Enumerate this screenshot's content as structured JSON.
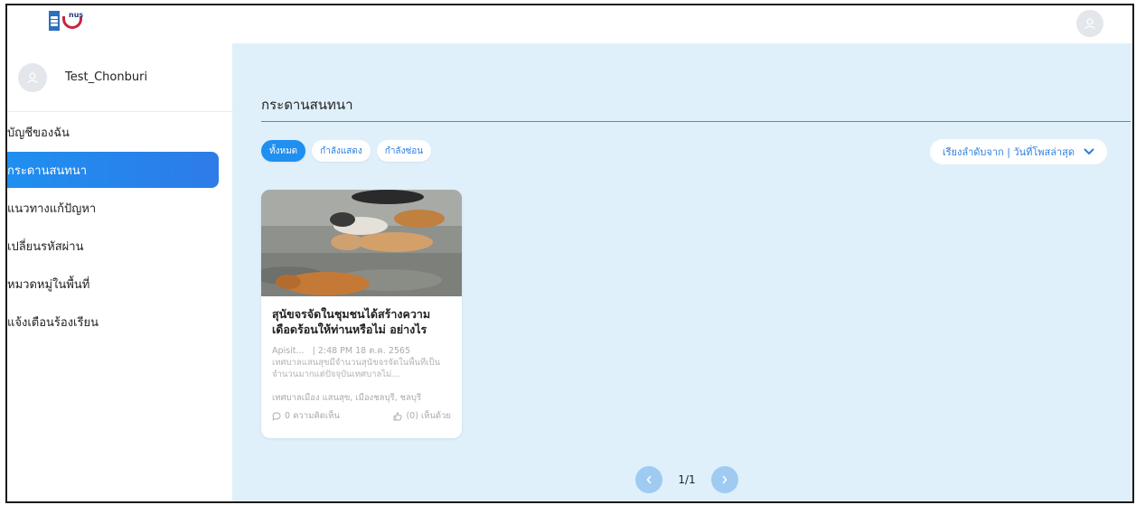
{
  "user": {
    "name": "Test_Chonburi"
  },
  "nav": [
    {
      "label": "บัญชีของฉัน",
      "active": false
    },
    {
      "label": "กระดานสนทนา",
      "active": true
    },
    {
      "label": "แนวทางแก้ปัญหา",
      "active": false
    },
    {
      "label": "เปลี่ยนรหัสผ่าน",
      "active": false
    },
    {
      "label": "หมวดหมู่ในพื้นที่",
      "active": false
    },
    {
      "label": "แจ้งเตือนร้องเรียน",
      "active": false
    }
  ],
  "main": {
    "title": "กระดานสนทนา",
    "filters": [
      {
        "label": "ทั้งหมด",
        "active": true
      },
      {
        "label": "กำลังแสดง",
        "active": false
      },
      {
        "label": "กำลังซ่อน",
        "active": false
      }
    ],
    "sort_label": "เรียงลำดับจาก | วันที่โพสล่าสุด"
  },
  "posts": [
    {
      "title": "สุนัขจรจัดในชุมชนได้สร้างความเดือดร้อนให้ท่านหรือไม่ อย่างไร",
      "author": "Apisit...",
      "datetime": "| 2:48 PM 18 ต.ค. 2565",
      "excerpt": "เทศบาลแสนสุขมีจำนวนสุนัขจรจัดในพื้นที่เป็นจำนวนมากแต่ปัจจุบันเทศบาลไม่...",
      "location": "เทศบาลเมือง แสนสุข, เมืองชลบุรี, ชลบุรี",
      "comments": "0 ความคิดเห็น",
      "agree": "(0) เห็นด้วย"
    }
  ],
  "pagination": {
    "text": "1/1"
  },
  "colors": {
    "accent": "#1f8ff0",
    "main_bg": "#dff0fa",
    "line": "#3f8fd8"
  }
}
